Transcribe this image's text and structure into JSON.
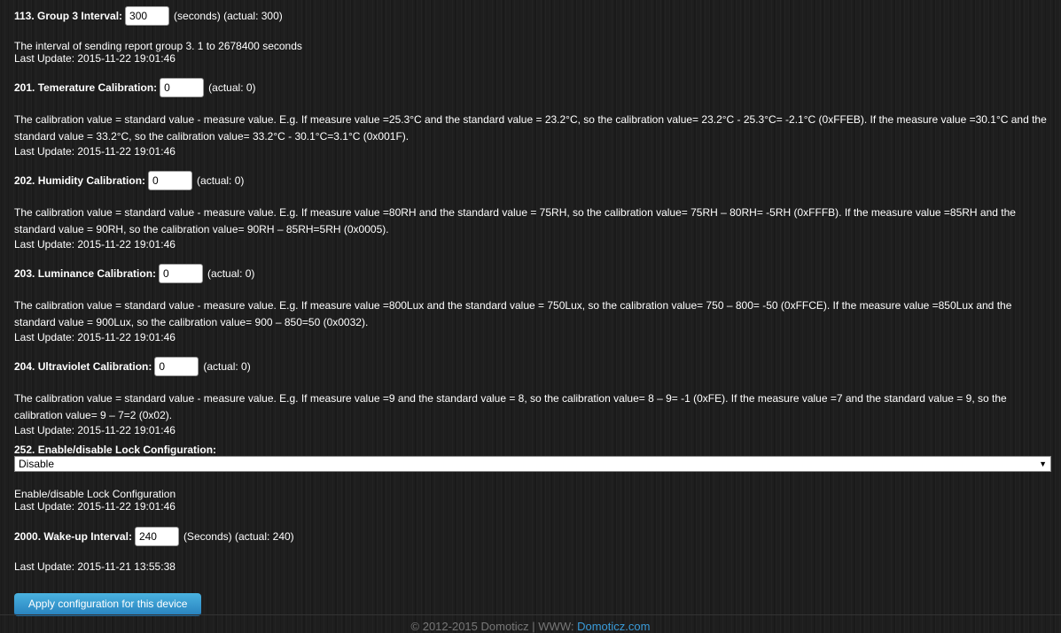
{
  "params": [
    {
      "label": "113. Group 3 Interval:",
      "value": "300",
      "suffix": "(seconds) (actual: 300)",
      "desc": "The interval of sending report group 3. 1 to 2678400 seconds",
      "update": "Last Update: 2015-11-22 19:01:46"
    },
    {
      "label": "201. Temerature Calibration:",
      "value": "0",
      "suffix": "(actual: 0)",
      "desc": "The calibration value = standard value - measure value. E.g. If measure value =25.3°C and the standard value = 23.2°C, so the calibration value= 23.2°C - 25.3°C= -2.1°C (0xFFEB). If the measure value =30.1°C and the standard value = 33.2°C, so the calibration value= 33.2°C - 30.1°C=3.1°C (0x001F).",
      "update": "Last Update: 2015-11-22 19:01:46"
    },
    {
      "label": "202. Humidity Calibration:",
      "value": "0",
      "suffix": "(actual: 0)",
      "desc": "The calibration value = standard value - measure value. E.g. If measure value =80RH and the standard value = 75RH, so the calibration value= 75RH – 80RH= -5RH (0xFFFB). If the measure value =85RH and the standard value = 90RH, so the calibration value= 90RH – 85RH=5RH (0x0005).",
      "update": "Last Update: 2015-11-22 19:01:46"
    },
    {
      "label": "203. Luminance Calibration:",
      "value": "0",
      "suffix": "(actual: 0)",
      "desc": "The calibration value = standard value - measure value. E.g. If measure value =800Lux and the standard value = 750Lux, so the calibration value= 750 – 800= -50 (0xFFCE). If the measure value =850Lux and the standard value = 900Lux, so the calibration value= 900 – 850=50 (0x0032).",
      "update": "Last Update: 2015-11-22 19:01:46"
    },
    {
      "label": "204. Ultraviolet Calibration:",
      "value": "0",
      "suffix": "(actual: 0)",
      "desc": "The calibration value = standard value - measure value. E.g. If measure value =9 and the standard value = 8, so the calibration value= 8 – 9= -1 (0xFE). If the measure value =7 and the standard value = 9, so the calibration value= 9 – 7=2 (0x02).",
      "update": "Last Update: 2015-11-22 19:01:46"
    }
  ],
  "lock": {
    "label": "252. Enable/disable Lock Configuration:",
    "selected": "Disable",
    "desc": "Enable/disable Lock Configuration",
    "update": "Last Update: 2015-11-22 19:01:46"
  },
  "wakeup": {
    "label": "2000. Wake-up Interval:",
    "value": "240",
    "suffix": "(Seconds) (actual: 240)",
    "update": "Last Update: 2015-11-21 13:55:38"
  },
  "apply_label": "Apply configuration for this device",
  "footer": {
    "text": "© 2012-2015 Domoticz | WWW: ",
    "link": "Domoticz.com"
  }
}
